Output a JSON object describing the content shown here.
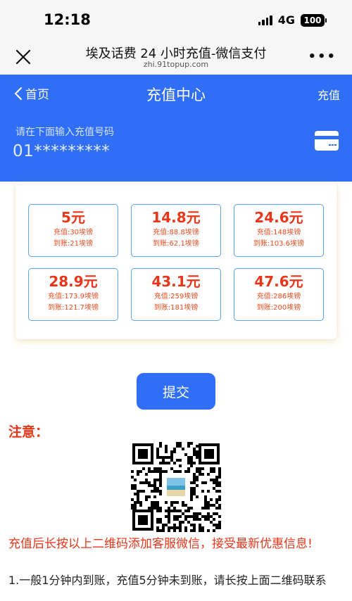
{
  "status_bar": {
    "time": "12:18",
    "network": "4G",
    "battery": "100"
  },
  "browser": {
    "title": "埃及话费 24 小时充值-微信支付",
    "url": "zhi.91topup.com",
    "close_icon": "close-icon",
    "more_icon": "more-icon"
  },
  "header": {
    "back_label": "首页",
    "title": "充值中心",
    "right_label": "充值",
    "accent_color": "#2f6ef5"
  },
  "phone": {
    "hint": "请在下面输入充值号码",
    "value": "01*********"
  },
  "packages": [
    {
      "price": "5元",
      "charge": "充值:30埃镑",
      "receive": "到账:21埃镑"
    },
    {
      "price": "14.8元",
      "charge": "充值:88.8埃镑",
      "receive": "到账:62.1埃镑"
    },
    {
      "price": "24.6元",
      "charge": "充值:148埃镑",
      "receive": "到账:103.6埃镑"
    },
    {
      "price": "28.9元",
      "charge": "充值:173.9埃镑",
      "receive": "到账:121.7埃镑"
    },
    {
      "price": "43.1元",
      "charge": "充值:259埃镑",
      "receive": "到账:181埃镑"
    },
    {
      "price": "47.6元",
      "charge": "充值:286埃镑",
      "receive": "到账:200埃镑"
    }
  ],
  "submit_label": "提交",
  "notice": {
    "title": "注意：",
    "text": "充值后长按以上二维码添加客服微信，接受最新优惠信息!",
    "item1": "1.一般1分钟内到账，充值5分钟未到账，请长按上面二维码联系"
  }
}
